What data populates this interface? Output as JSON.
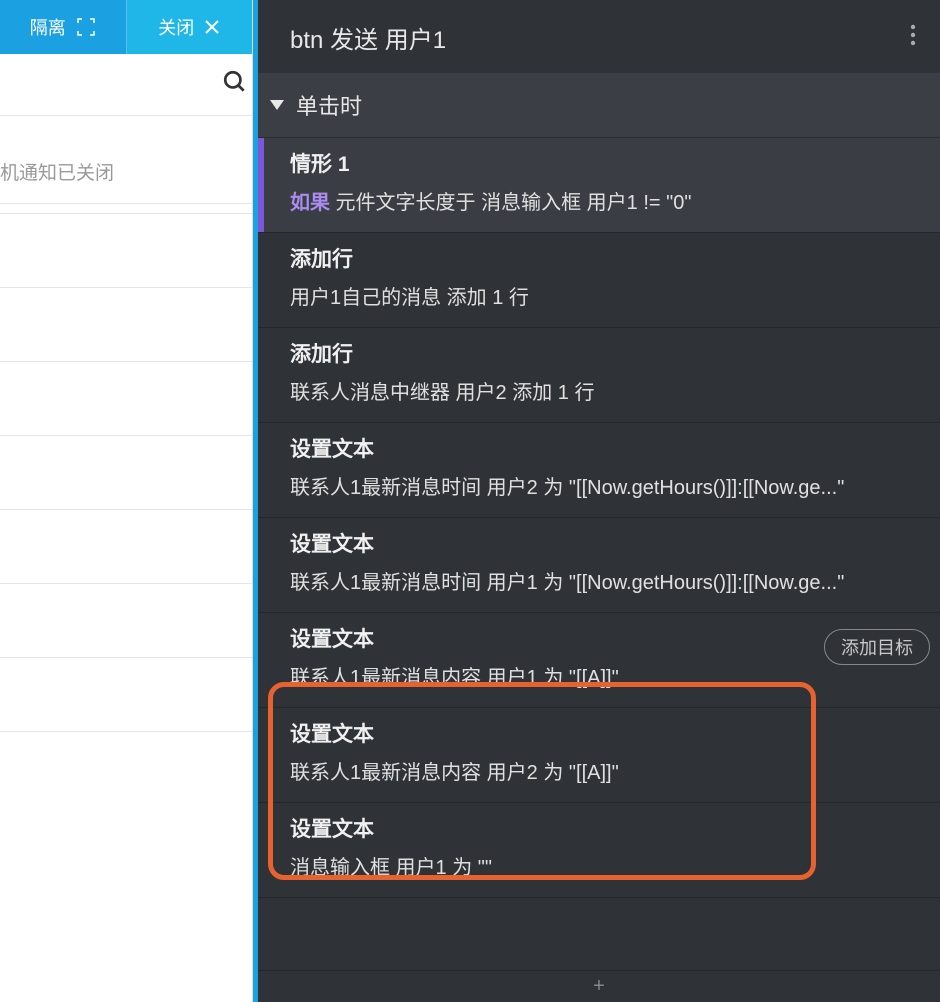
{
  "tabs": {
    "isolate": "隔离",
    "close": "关闭"
  },
  "left": {
    "notification": "机通知已关闭"
  },
  "panel": {
    "title": "btn 发送 用户1",
    "sectionHeader": "单击时"
  },
  "case": {
    "title": "情形 1",
    "ifKeyword": "如果",
    "condition": " 元件文字长度于 消息输入框 用户1 != \"0\""
  },
  "actions": [
    {
      "title": "添加行",
      "detail": "用户1自己的消息 添加 1 行"
    },
    {
      "title": "添加行",
      "detail": "联系人消息中继器 用户2 添加 1 行"
    },
    {
      "title": "设置文本",
      "detail": "联系人1最新消息时间 用户2 为 \"[[Now.getHours()]]:[[Now.ge...\""
    },
    {
      "title": "设置文本",
      "detail": "联系人1最新消息时间 用户1 为 \"[[Now.getHours()]]:[[Now.ge...\""
    },
    {
      "title": "设置文本",
      "detail": "联系人1最新消息内容 用户1 为 \"[[A]]\"",
      "hasAddTarget": true
    },
    {
      "title": "设置文本",
      "detail": "联系人1最新消息内容 用户2 为 \"[[A]]\""
    },
    {
      "title": "设置文本",
      "detail": "消息输入框 用户1 为 \"\""
    }
  ],
  "addTargetLabel": "添加目标",
  "footerPlus": "+"
}
